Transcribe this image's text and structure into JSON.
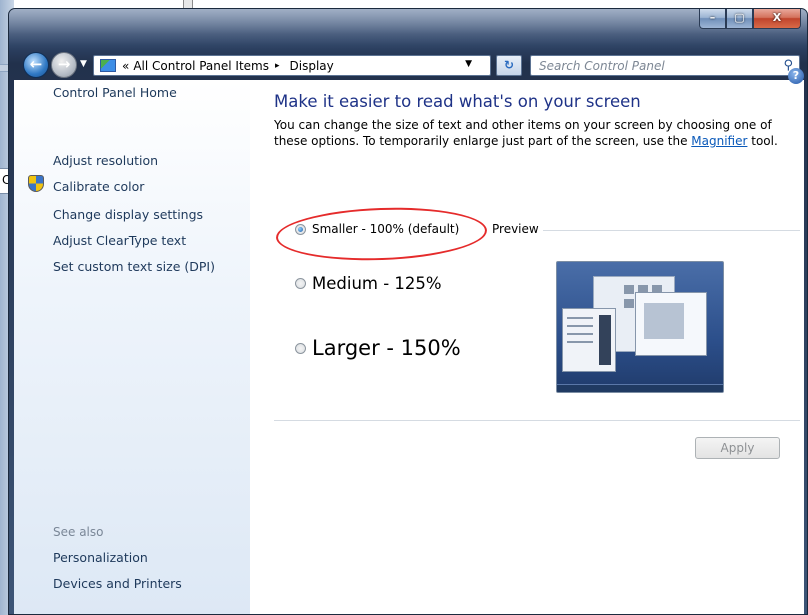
{
  "window": {
    "caption_buttons": {
      "minimize": "–",
      "maximize": "▢",
      "close": "X"
    }
  },
  "navigation": {
    "back_icon": "back-arrow-icon",
    "forward_icon": "forward-arrow-icon",
    "breadcrumb_chevron": "«",
    "breadcrumb": [
      "All Control Panel Items",
      "Display"
    ],
    "breadcrumb_separator": "▸",
    "search_placeholder": "Search Control Panel"
  },
  "sidebar": {
    "home": "Control Panel Home",
    "items": [
      {
        "label": "Adjust resolution"
      },
      {
        "label": "Calibrate color",
        "icon": "shield-icon"
      },
      {
        "label": "Change display settings"
      },
      {
        "label": "Adjust ClearType text"
      },
      {
        "label": "Set custom text size (DPI)"
      }
    ],
    "see_also_heading": "See also",
    "see_also": [
      {
        "label": "Personalization"
      },
      {
        "label": "Devices and Printers"
      }
    ]
  },
  "main": {
    "help_icon": "?",
    "title": "Make it easier to read what's on your screen",
    "description_pre": "You can change the size of text and other items on your screen by choosing one of these options. To temporarily enlarge just part of the screen, use the ",
    "description_link": "Magnifier",
    "description_post": " tool.",
    "options": [
      {
        "label": "Smaller - 100% (default)",
        "selected": true
      },
      {
        "label": "Medium - 125%",
        "selected": false
      },
      {
        "label": "Larger - 150%",
        "selected": false
      }
    ],
    "preview_label": "Preview",
    "apply_button": "Apply",
    "apply_enabled": false
  },
  "annotation": {
    "highlight_color": "#e52b2b"
  },
  "colors": {
    "link": "#1e395b",
    "title": "#1e3287",
    "hyperlink": "#0a59b9"
  }
}
